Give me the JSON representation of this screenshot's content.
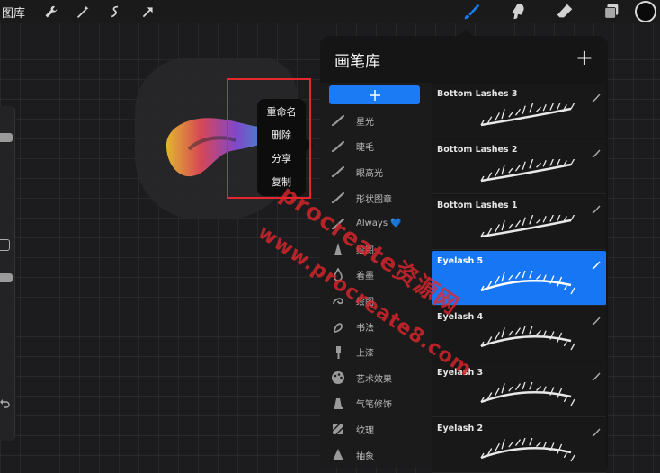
{
  "topbar": {
    "gallery_label": "图库",
    "tools": [
      "wrench-icon",
      "magic-wand-icon",
      "selection-icon",
      "transform-arrow-icon"
    ],
    "right_tools": [
      "brush-icon",
      "smudge-icon",
      "eraser-icon",
      "layers-icon"
    ],
    "current_color": "#0a0a0a"
  },
  "context_menu": {
    "items": [
      "重命名",
      "删除",
      "分享",
      "复制"
    ]
  },
  "panel": {
    "title": "画笔库",
    "add_symbol": "+",
    "categories": [
      {
        "label": "星光",
        "icon": "stroke-icon"
      },
      {
        "label": "睫毛",
        "icon": "stroke-icon"
      },
      {
        "label": "眼高光",
        "icon": "stroke-icon"
      },
      {
        "label": "形状图章",
        "icon": "stroke-icon"
      },
      {
        "label": "Always",
        "icon": "stroke-icon",
        "suffix": "💙"
      },
      {
        "label": "绘图",
        "icon": "pencil-tip-icon"
      },
      {
        "label": "着墨",
        "icon": "ink-drop-icon"
      },
      {
        "label": "绘图",
        "icon": "swirl-icon"
      },
      {
        "label": "书法",
        "icon": "calligraphy-icon"
      },
      {
        "label": "上漆",
        "icon": "paint-brush-icon"
      },
      {
        "label": "艺术效果",
        "icon": "palette-icon"
      },
      {
        "label": "气笔修饰",
        "icon": "airbrush-icon"
      },
      {
        "label": "纹理",
        "icon": "texture-icon"
      },
      {
        "label": "抽象",
        "icon": "abstract-icon"
      }
    ],
    "brushes": [
      {
        "name": "Bottom Lashes 3",
        "selected": false
      },
      {
        "name": "Bottom Lashes 2",
        "selected": false
      },
      {
        "name": "Bottom Lashes 1",
        "selected": false
      },
      {
        "name": "Eyelash 5",
        "selected": true
      },
      {
        "name": "Eyelash 4",
        "selected": false
      },
      {
        "name": "Eyelash 3",
        "selected": false
      },
      {
        "name": "Eyelash 2",
        "selected": false
      }
    ]
  },
  "watermark": {
    "line1": "procreate资源网",
    "line2": "www.procreate8.com"
  },
  "colors": {
    "accent": "#1a7bf5",
    "highlight_frame": "#e4262d"
  }
}
